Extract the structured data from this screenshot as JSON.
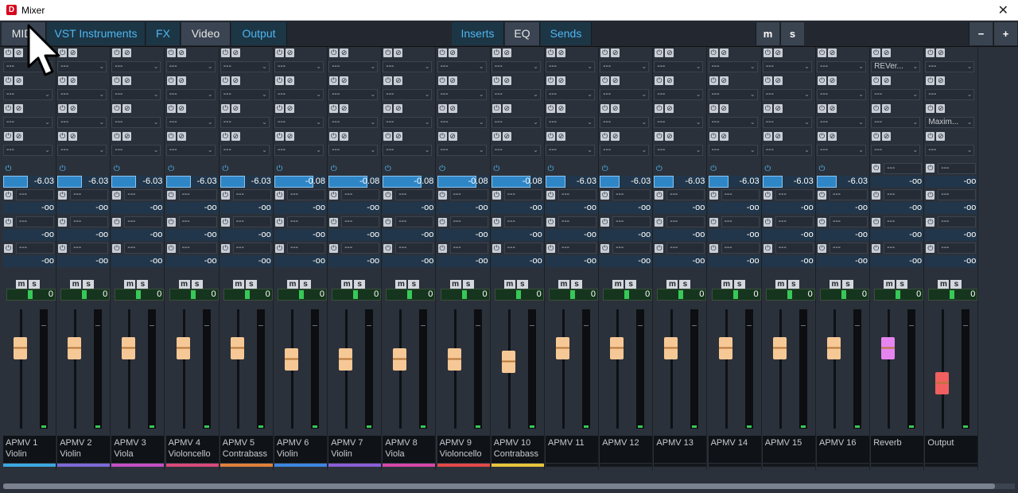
{
  "window": {
    "title": "Mixer",
    "app_icon": "D",
    "close_label": "✕"
  },
  "toolbar": {
    "tabs": [
      {
        "label": "MIDI"
      },
      {
        "label": "VST Instruments"
      },
      {
        "label": "FX"
      },
      {
        "label": "Video"
      },
      {
        "label": "Output"
      }
    ],
    "rack_tabs": [
      {
        "label": "Inserts"
      },
      {
        "label": "EQ"
      },
      {
        "label": "Sends"
      }
    ],
    "buttons": {
      "mute_all": "m",
      "solo_all": "s",
      "minus": "−",
      "plus": "+"
    }
  },
  "colors": {
    "background": "#2b313a",
    "accent": "#4fb6f0",
    "send_fill": "#2f86c6",
    "fader_cap_default": "#f6c896",
    "fader_cap_reverb": "#e685f0",
    "fader_cap_output": "#f06060",
    "pan_on": "#37c957"
  },
  "channels": [
    {
      "name": "APMV 1",
      "instrument": "Violin",
      "color": "#3da7e0",
      "inserts": [
        "---",
        "---",
        "---",
        "---"
      ],
      "send1": "-6.03",
      "send1_level": 0.62,
      "fader_db": "0",
      "pan": "0",
      "fader_level": 0.67,
      "cap": "#f6c896"
    },
    {
      "name": "APMV 2",
      "instrument": "Violin",
      "color": "#7d6ad6",
      "inserts": [
        "---",
        "---",
        "---",
        "---"
      ],
      "send1": "-6.03",
      "send1_level": 0.62,
      "fader_db": "0",
      "pan": "0",
      "fader_level": 0.67,
      "cap": "#f6c896"
    },
    {
      "name": "APMV 3",
      "instrument": "Viola",
      "color": "#c34fc3",
      "inserts": [
        "---",
        "---",
        "---",
        "---"
      ],
      "send1": "-6.03",
      "send1_level": 0.62,
      "fader_db": "0",
      "pan": "0",
      "fader_level": 0.67,
      "cap": "#f6c896"
    },
    {
      "name": "APMV 4",
      "instrument": "Violoncello",
      "color": "#d94a7b",
      "inserts": [
        "---",
        "---",
        "---",
        "---"
      ],
      "send1": "-6.03",
      "send1_level": 0.62,
      "fader_db": "0",
      "pan": "0",
      "fader_level": 0.67,
      "cap": "#f6c896"
    },
    {
      "name": "APMV 5",
      "instrument": "Contrabass",
      "color": "#e0813a",
      "inserts": [
        "---",
        "---",
        "---",
        "---"
      ],
      "send1": "-6.03",
      "send1_level": 0.62,
      "fader_db": "0",
      "pan": "0",
      "fader_level": 0.67,
      "cap": "#f6c896"
    },
    {
      "name": "APMV 6",
      "instrument": "Violin",
      "color": "#3d86df",
      "inserts": [
        "---",
        "---",
        "---",
        "---"
      ],
      "send1": "-0.08",
      "send1_level": 0.98,
      "fader_db": "0",
      "pan": "0",
      "fader_level": 0.58,
      "cap": "#f6c896"
    },
    {
      "name": "APMV 7",
      "instrument": "Violin",
      "color": "#8a5fd6",
      "inserts": [
        "---",
        "---",
        "---",
        "---"
      ],
      "send1": "-0.08",
      "send1_level": 0.98,
      "fader_db": "0",
      "pan": "0",
      "fader_level": 0.58,
      "cap": "#f6c896"
    },
    {
      "name": "APMV 8",
      "instrument": "Viola",
      "color": "#d548a8",
      "inserts": [
        "---",
        "---",
        "---",
        "---"
      ],
      "send1": "-0.08",
      "send1_level": 0.98,
      "fader_db": "0",
      "pan": "0",
      "fader_level": 0.58,
      "cap": "#f6c896"
    },
    {
      "name": "APMV 9",
      "instrument": "Violoncello",
      "color": "#e04a4a",
      "inserts": [
        "---",
        "---",
        "---",
        "---"
      ],
      "send1": "-0.08",
      "send1_level": 0.98,
      "fader_db": "0",
      "pan": "0",
      "fader_level": 0.58,
      "cap": "#f6c896"
    },
    {
      "name": "APMV 10",
      "instrument": "Contrabass",
      "color": "#e8c43a",
      "inserts": [
        "---",
        "---",
        "---",
        "---"
      ],
      "send1": "-0.08",
      "send1_level": 0.98,
      "fader_db": "0",
      "pan": "0",
      "fader_level": 0.56,
      "cap": "#f6c896"
    },
    {
      "name": "APMV 11",
      "instrument": "",
      "color": "#14181d",
      "inserts": [
        "---",
        "---",
        "---",
        "---"
      ],
      "send1": "-6.03",
      "send1_level": 0.5,
      "fader_db": "0",
      "pan": "0",
      "fader_level": 0.67,
      "cap": "#f6c896"
    },
    {
      "name": "APMV 12",
      "instrument": "",
      "color": "#14181d",
      "inserts": [
        "---",
        "---",
        "---",
        "---"
      ],
      "send1": "-6.03",
      "send1_level": 0.5,
      "fader_db": "0",
      "pan": "0",
      "fader_level": 0.67,
      "cap": "#f6c896"
    },
    {
      "name": "APMV 13",
      "instrument": "",
      "color": "#14181d",
      "inserts": [
        "---",
        "---",
        "---",
        "---"
      ],
      "send1": "-6.03",
      "send1_level": 0.5,
      "fader_db": "0",
      "pan": "0",
      "fader_level": 0.67,
      "cap": "#f6c896"
    },
    {
      "name": "APMV 14",
      "instrument": "",
      "color": "#14181d",
      "inserts": [
        "---",
        "---",
        "---",
        "---"
      ],
      "send1": "-6.03",
      "send1_level": 0.5,
      "fader_db": "0",
      "pan": "0",
      "fader_level": 0.67,
      "cap": "#f6c896"
    },
    {
      "name": "APMV 15",
      "instrument": "",
      "color": "#14181d",
      "inserts": [
        "---",
        "---",
        "---",
        "---"
      ],
      "send1": "-6.03",
      "send1_level": 0.5,
      "fader_db": "0",
      "pan": "0",
      "fader_level": 0.67,
      "cap": "#f6c896"
    },
    {
      "name": "APMV 16",
      "instrument": "",
      "color": "#14181d",
      "inserts": [
        "---",
        "---",
        "---",
        "---"
      ],
      "send1": "-6.03",
      "send1_level": 0.5,
      "fader_db": "0",
      "pan": "0",
      "fader_level": 0.67,
      "cap": "#f6c896"
    },
    {
      "name": "Reverb",
      "instrument": "",
      "color": "#14181d",
      "inserts": [
        "REVer...",
        "---",
        "---",
        "---"
      ],
      "send1": "---",
      "send1_level": 0,
      "fader_db": "0",
      "pan": "0",
      "fader_level": 0.67,
      "cap": "#e685f0"
    },
    {
      "name": "Output",
      "instrument": "",
      "color": "#14181d",
      "inserts": [
        "---",
        "---",
        "Maxim...",
        "---"
      ],
      "send1": "---",
      "send1_level": 0,
      "fader_db": "0",
      "pan": "0",
      "fader_level": 0.38,
      "cap": "#f06060"
    }
  ],
  "send_off_values": [
    "-oo",
    "-oo",
    "-oo",
    "-oo"
  ],
  "send_empty_label": "---",
  "strip_ms": {
    "m": "m",
    "s": "s"
  }
}
